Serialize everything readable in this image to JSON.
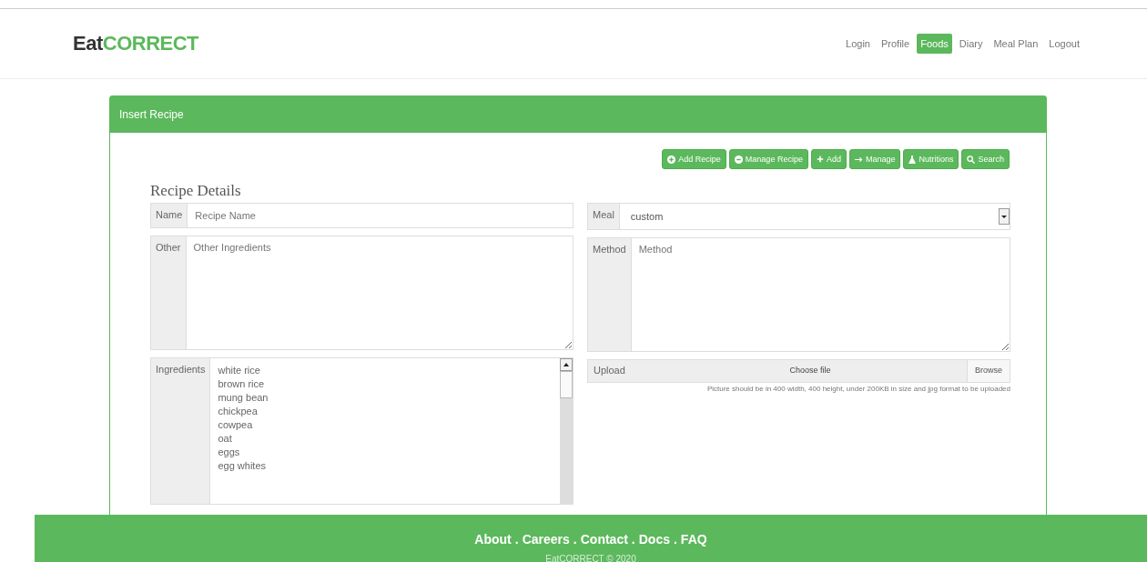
{
  "logo": {
    "dark": "Eat",
    "green": "CORRECT"
  },
  "nav": [
    {
      "label": "Login",
      "selected": false
    },
    {
      "label": "Profile",
      "selected": false
    },
    {
      "label": "Foods",
      "selected": true
    },
    {
      "label": "Diary",
      "selected": false
    },
    {
      "label": "Meal Plan",
      "selected": false
    },
    {
      "label": "Logout",
      "selected": false
    }
  ],
  "panel": {
    "title": "Insert Recipe",
    "toolbar": [
      {
        "kind": "plus-circle",
        "label": "Add Recipe"
      },
      {
        "kind": "minus-circle",
        "label": "Manage Recipe"
      },
      {
        "kind": "plus",
        "label": "Add"
      },
      {
        "kind": "arrow",
        "label": "Manage"
      },
      {
        "kind": "flask",
        "label": "Nutritions"
      },
      {
        "kind": "search",
        "label": "Search"
      }
    ],
    "heading": "Recipe Details",
    "name": {
      "label": "Name",
      "placeholder": "Recipe Name"
    },
    "meal": {
      "label": "Meal",
      "value": "custom"
    },
    "other": {
      "label": "Other",
      "placeholder": "Other Ingredients"
    },
    "method": {
      "label": "Method",
      "placeholder": "Method"
    },
    "ingredients": {
      "label": "Ingredients",
      "options": [
        "white rice",
        "brown rice",
        "mung bean",
        "chickpea",
        "cowpea",
        "oat",
        "eggs",
        "egg whites"
      ]
    },
    "upload": {
      "label": "Upload",
      "file_text": "Choose file",
      "browse": "Browse",
      "hint": "Picture should be in 400 width, 400 height, under 200KB in size and jpg format to be uploaded"
    }
  },
  "footer": {
    "links": [
      "About",
      "Careers",
      "Contact",
      "Docs",
      "FAQ"
    ],
    "separator": ".",
    "copyright": "EatCORRECT © 2020"
  }
}
